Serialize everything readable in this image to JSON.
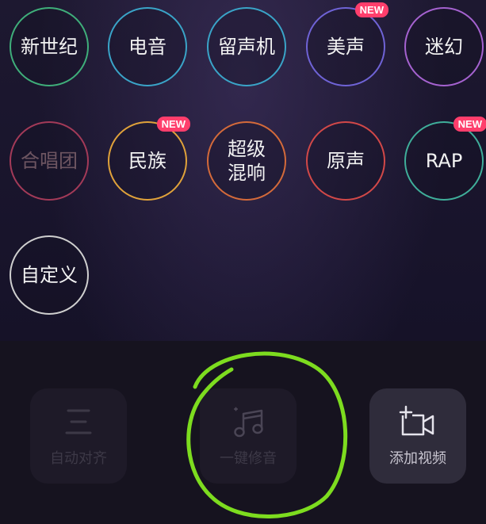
{
  "effects": [
    {
      "label": "新世纪",
      "color": "#3fae7a",
      "badge": null,
      "dim": false
    },
    {
      "label": "电音",
      "color": "#3aa4c8",
      "badge": null,
      "dim": false
    },
    {
      "label": "留声机",
      "color": "#3aa4c8",
      "badge": null,
      "dim": false
    },
    {
      "label": "美声",
      "color": "#6f63d6",
      "badge": "NEW",
      "dim": false
    },
    {
      "label": "迷幻",
      "color": "#a562d0",
      "badge": null,
      "dim": false
    },
    {
      "label": "合唱团",
      "color": "#a33a58",
      "badge": null,
      "dim": true
    },
    {
      "label": "民族",
      "color": "#e0a23a",
      "badge": "NEW",
      "dim": false
    },
    {
      "label": "超级\n混响",
      "color": "#d46a3a",
      "badge": null,
      "dim": false
    },
    {
      "label": "原声",
      "color": "#d24848",
      "badge": null,
      "dim": false
    },
    {
      "label": "RAP",
      "color": "#3fae9a",
      "badge": "NEW",
      "dim": false
    },
    {
      "label": "自定义",
      "color": "#cfcfcf",
      "badge": null,
      "dim": false
    }
  ],
  "bottom_tools": [
    {
      "label": "自动对齐",
      "state": "disabled",
      "icon": "align-lines-icon"
    },
    {
      "label": "一键修音",
      "state": "disabled",
      "icon": "music-note-sparkle-icon"
    },
    {
      "label": "添加视频",
      "state": "active",
      "icon": "add-video-icon"
    }
  ],
  "colors": {
    "badge": "#ff3e6c",
    "annotation": "#7ddc1f"
  }
}
